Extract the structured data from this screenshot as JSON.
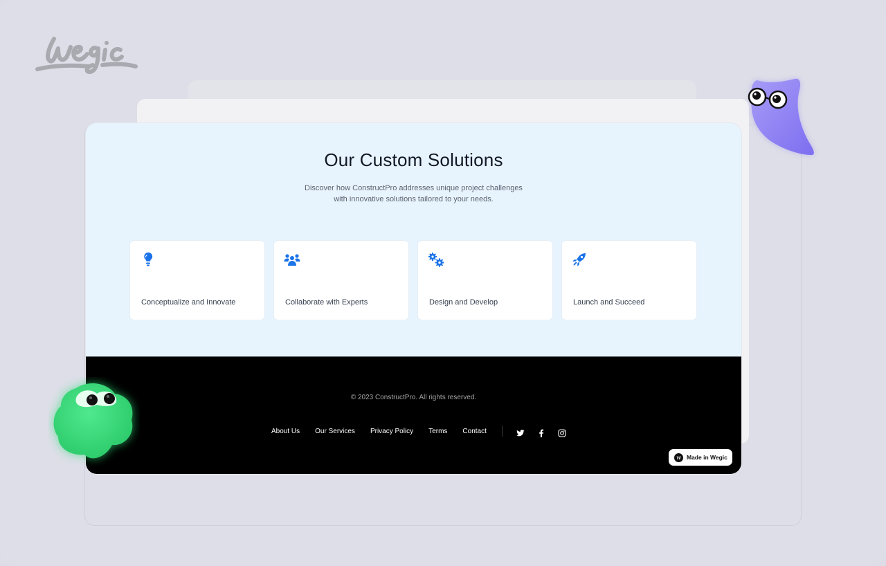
{
  "brand": {
    "logo_text": "Wegic"
  },
  "hero": {
    "title": "Our Custom Solutions",
    "subtitle_line1": "Discover how ConstructPro addresses unique project challenges",
    "subtitle_line2": "with innovative solutions tailored to your needs."
  },
  "cards": [
    {
      "icon": "lightbulb-icon",
      "label": "Conceptualize and Innovate"
    },
    {
      "icon": "users-icon",
      "label": "Collaborate with Experts"
    },
    {
      "icon": "gears-icon",
      "label": "Design and Develop"
    },
    {
      "icon": "rocket-icon",
      "label": "Launch and Succeed"
    }
  ],
  "footer": {
    "copyright": "© 2023 ConstructPro. All rights reserved.",
    "links": [
      "About Us",
      "Our Services",
      "Privacy Policy",
      "Terms",
      "Contact"
    ],
    "social": [
      "twitter-icon",
      "facebook-icon",
      "instagram-icon"
    ]
  },
  "badge": {
    "logo": "w",
    "label": "Made in Wegic"
  },
  "colors": {
    "accent": "#1a73e8",
    "hero_bg": "#e8f4fd",
    "footer_bg": "#000000",
    "page_bg": "#dcdde6"
  }
}
